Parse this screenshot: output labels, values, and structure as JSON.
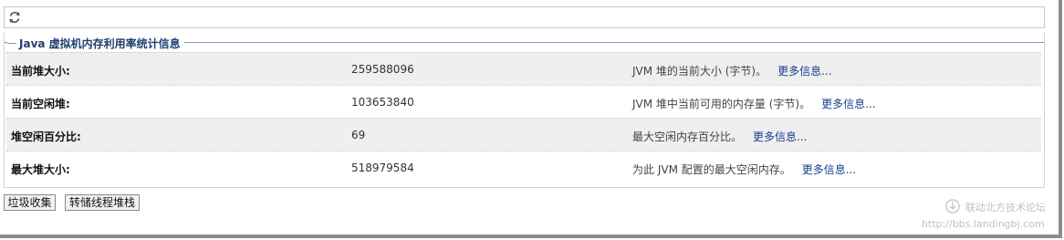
{
  "toolbar": {
    "refresh_icon": "refresh-icon"
  },
  "section": {
    "title": "Java 虚拟机内存利用率统计信息"
  },
  "rows": [
    {
      "label": "当前堆大小:",
      "value": "259588096",
      "description": "JVM 堆的当前大小 (字节)。",
      "more": "更多信息..."
    },
    {
      "label": "当前空闲堆:",
      "value": "103653840",
      "description": "JVM 堆中当前可用的内存量 (字节)。",
      "more": "更多信息..."
    },
    {
      "label": "堆空闲百分比:",
      "value": "69",
      "description": "最大空闲内存百分比。",
      "more": "更多信息..."
    },
    {
      "label": "最大堆大小:",
      "value": "518979584",
      "description": "为此 JVM 配置的最大空闲内存。",
      "more": "更多信息..."
    }
  ],
  "buttons": {
    "gc": "垃圾收集",
    "dump": "转储线程堆栈"
  },
  "watermark": {
    "name": "联动北方技术论坛",
    "url": "http://bbs.landingbj.com"
  },
  "colors": {
    "legend": "#1f3f6f",
    "link": "#1a3e8c",
    "alt_row": "#efefef"
  }
}
